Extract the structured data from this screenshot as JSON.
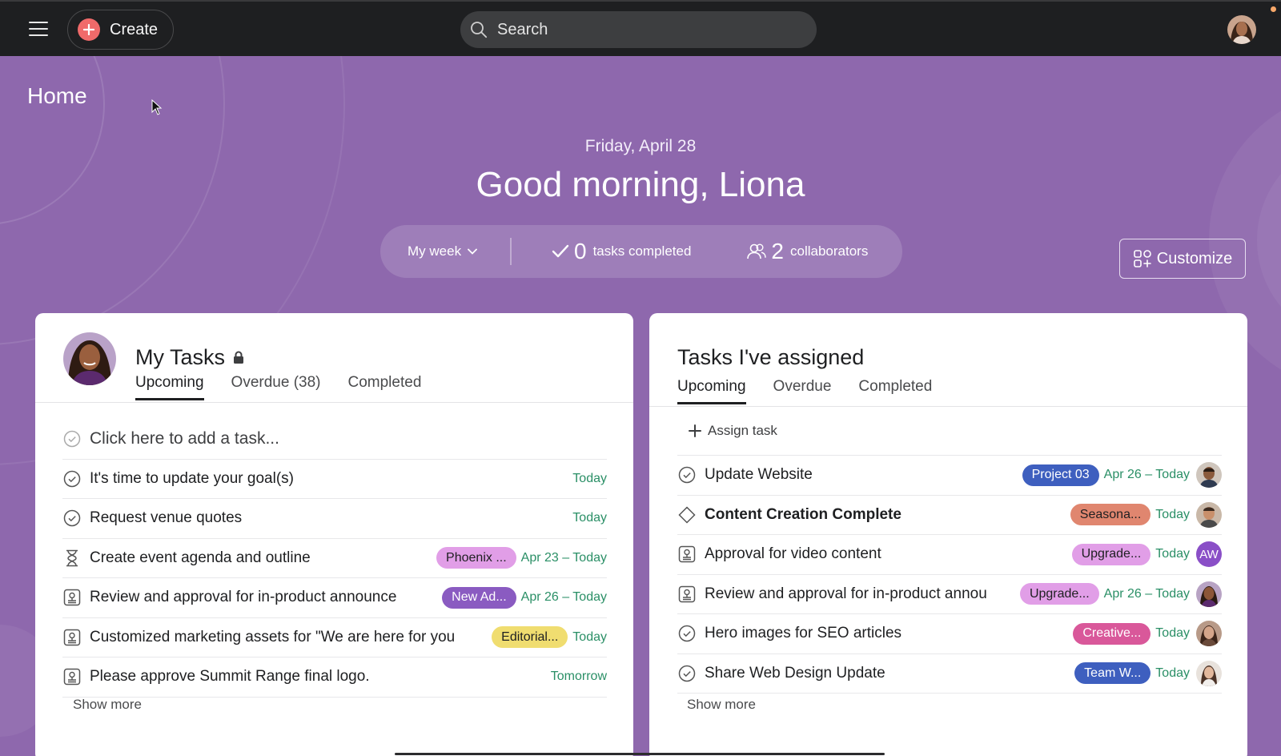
{
  "topbar": {
    "create_label": "Create",
    "search_placeholder": "Search"
  },
  "home": {
    "title": "Home",
    "date": "Friday, April 28",
    "greeting": "Good morning, Liona"
  },
  "stats": {
    "week_label": "My week",
    "tasks_count": "0",
    "tasks_label": "tasks completed",
    "collab_count": "2",
    "collab_label": "collaborators"
  },
  "customize_label": "Customize",
  "my_tasks": {
    "title": "My Tasks",
    "tabs": [
      "Upcoming",
      "Overdue (38)",
      "Completed"
    ],
    "add_placeholder": "Click here to add a task...",
    "rows": [
      {
        "name": "It's time to update your goal(s)",
        "due": "Today"
      },
      {
        "name": "Request venue quotes",
        "due": "Today"
      },
      {
        "name": "Create event agenda and outline",
        "tag": "Phoenix ...",
        "tag_bg": "#e19ee7",
        "due": "Apr 23 – Today"
      },
      {
        "name": "Review and approval for in-product announce",
        "tag": "New Ad...",
        "tag_bg": "#8a5bc1",
        "due": "Apr 26 – Today"
      },
      {
        "name": "Customized marketing assets for \"We are here for you",
        "tag": "Editorial...",
        "tag_bg": "#f0dd70",
        "due": "Today"
      },
      {
        "name": "Please approve Summit Range final logo.",
        "due": "Tomorrow"
      }
    ],
    "show_more": "Show more"
  },
  "assigned": {
    "title": "Tasks I've assigned",
    "tabs": [
      "Upcoming",
      "Overdue",
      "Completed"
    ],
    "assign_label": "Assign task",
    "rows": [
      {
        "name": "Update Website",
        "tag": "Project 03",
        "tag_bg": "#3e5fbf",
        "due": "Apr 26 – Today"
      },
      {
        "name": "Content Creation Complete",
        "tag": "Seasona...",
        "tag_bg": "#e0866f",
        "due": "Today"
      },
      {
        "name": "Approval for video content",
        "tag": "Upgrade...",
        "tag_bg": "#e19ee7",
        "due": "Today",
        "avatar_initials": "AW"
      },
      {
        "name": "Review and approval for in-product annou",
        "tag": "Upgrade...",
        "tag_bg": "#e19ee7",
        "due": "Apr 26 – Today"
      },
      {
        "name": "Hero images for SEO articles",
        "tag": "Creative...",
        "tag_bg": "#d9589a",
        "due": "Today"
      },
      {
        "name": "Share Web Design Update",
        "tag": "Team W...",
        "tag_bg": "#3e5fbf",
        "due": "Today"
      }
    ],
    "show_more": "Show more"
  },
  "colors": {
    "topbar": "#1e1f21",
    "hero": "#8e68ad",
    "create_plus": "#f06a6a",
    "due_green": "#2a8f66"
  }
}
